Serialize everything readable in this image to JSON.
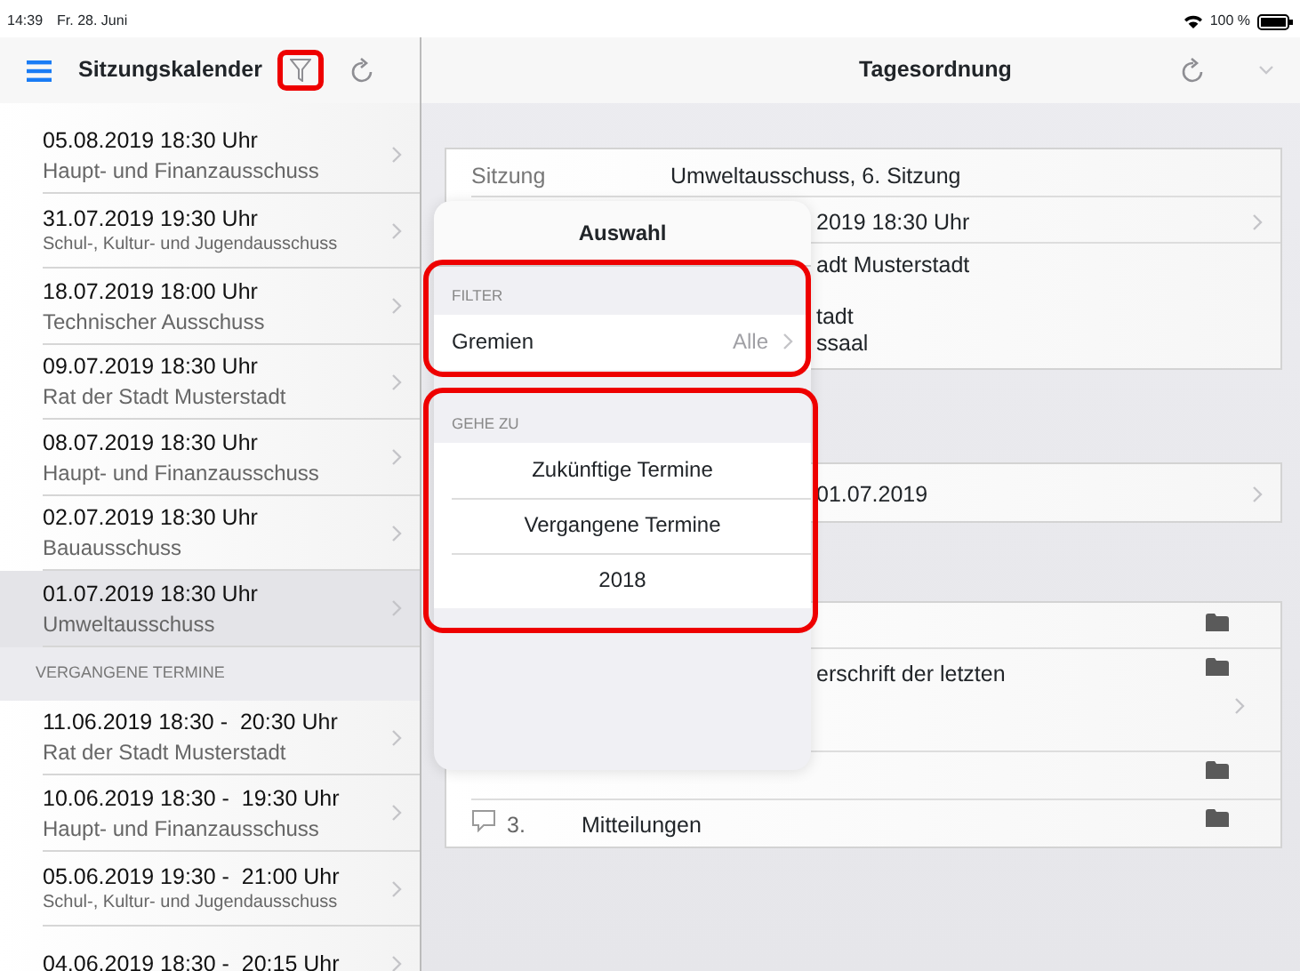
{
  "status_bar": {
    "time": "14:39",
    "date": "Fr. 28. Juni",
    "battery": "100 %"
  },
  "sidebar": {
    "title": "Sitzungskalender",
    "filter_highlighted": true,
    "sections": [
      {
        "items": [
          {
            "date": "05.08.2019 18:30 Uhr",
            "committee": "Haupt- und Finanzausschuss",
            "selected": false
          },
          {
            "date": "31.07.2019 19:30 Uhr",
            "committee": "Schul-, Kultur- und Jugendausschuss",
            "selected": false
          },
          {
            "date": "18.07.2019 18:00 Uhr",
            "committee": "Technischer Ausschuss",
            "selected": false
          },
          {
            "date": "09.07.2019 18:30 Uhr",
            "committee": "Rat der Stadt Musterstadt",
            "selected": false
          },
          {
            "date": "08.07.2019 18:30 Uhr",
            "committee": "Haupt- und Finanzausschuss",
            "selected": false
          },
          {
            "date": "02.07.2019 18:30 Uhr",
            "committee": "Bauausschuss",
            "selected": false
          },
          {
            "date": "01.07.2019 18:30 Uhr",
            "committee": "Umweltausschuss",
            "selected": true
          }
        ]
      },
      {
        "header": "VERGANGENE TERMINE",
        "items": [
          {
            "date": "11.06.2019 18:30 -  20:30 Uhr",
            "committee": "Rat der Stadt Musterstadt",
            "selected": false
          },
          {
            "date": "10.06.2019 18:30 -  19:30 Uhr",
            "committee": "Haupt- und Finanzausschuss",
            "selected": false
          },
          {
            "date": "05.06.2019 19:30 -  21:00 Uhr",
            "committee": "Schul-, Kultur- und Jugendausschuss",
            "selected": false
          },
          {
            "date": "04.06.2019 18:30 -  20:15 Uhr",
            "selected": false
          }
        ]
      }
    ]
  },
  "detail": {
    "title": "Tagesordnung",
    "info_rows": [
      {
        "label": "Sitzung",
        "value": "Umweltausschuss, 6. Sitzung"
      },
      {
        "value": "2019 18:30 Uhr",
        "chevron": true
      },
      {
        "lines": [
          "adt Musterstadt",
          "tadt",
          "ssaal"
        ]
      }
    ],
    "date_rows": [
      {
        "value": "01.07.2019",
        "chevron": true
      }
    ],
    "agenda": [
      {
        "documents": true
      },
      {
        "text": "erschrift der letzten",
        "documents": true,
        "chevron": true
      },
      {
        "documents": true
      },
      {
        "number": "3.",
        "text": "Mitteilungen",
        "comment_icon": true,
        "documents": true
      }
    ]
  },
  "popover": {
    "title": "Auswahl",
    "sections": [
      {
        "header": "FILTER",
        "highlighted": true,
        "rows": [
          {
            "kind": "disclosure",
            "label": "Gremien",
            "value": "Alle"
          }
        ]
      },
      {
        "header": "GEHE ZU",
        "highlighted": true,
        "rows": [
          {
            "kind": "action",
            "label": "Zukünftige Termine"
          },
          {
            "kind": "action",
            "label": "Vergangene Termine"
          },
          {
            "kind": "action",
            "label": "2018"
          }
        ]
      }
    ]
  }
}
